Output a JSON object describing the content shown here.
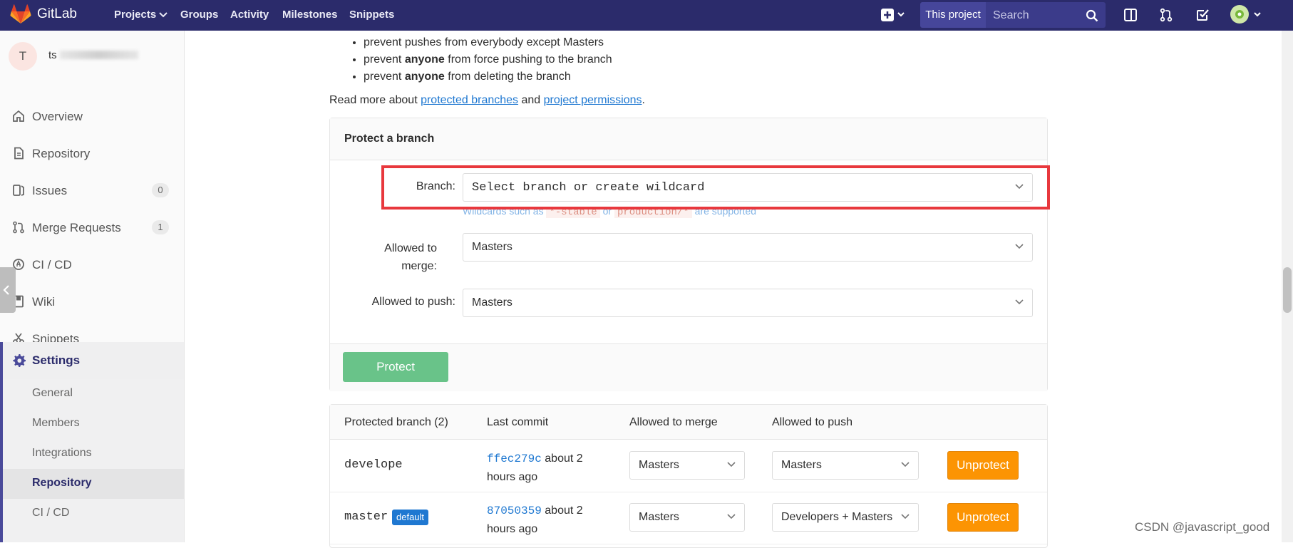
{
  "colors": {
    "navbar": "#2b2b6b",
    "link": "#1f78d1",
    "protect_button": "#69c389",
    "unprotect_button": "#fc9403",
    "highlight": "#e8383d",
    "badge": "#1f78d1"
  },
  "navbar": {
    "brand": "GitLab",
    "items": [
      "Projects",
      "Groups",
      "Activity",
      "Milestones",
      "Snippets"
    ],
    "icons": [
      "gitlab-logo-icon",
      "plus-icon",
      "sidebar-toggle-icon",
      "merge-request-icon",
      "todo-icon",
      "user-avatar-icon"
    ],
    "scope_label": "This project",
    "search_placeholder": "Search"
  },
  "sidebar": {
    "avatar_letter": "T",
    "project_name": "ts",
    "items": [
      {
        "label": "Overview",
        "icon": "home-icon"
      },
      {
        "label": "Repository",
        "icon": "document-icon"
      },
      {
        "label": "Issues",
        "icon": "issues-icon",
        "count": "0"
      },
      {
        "label": "Merge Requests",
        "icon": "merge-request-icon",
        "count": "1"
      },
      {
        "label": "CI / CD",
        "icon": "rocket-icon"
      },
      {
        "label": "Wiki",
        "icon": "book-icon"
      },
      {
        "label": "Snippets",
        "icon": "scissors-icon"
      },
      {
        "label": "Settings",
        "icon": "gear-icon"
      }
    ],
    "settings_sub": [
      "General",
      "Members",
      "Integrations",
      "Repository",
      "CI / CD"
    ]
  },
  "main": {
    "bullets": [
      {
        "before": "prevent pushes from everybody except Masters",
        "bold": "",
        "after": ""
      },
      {
        "before": "prevent ",
        "bold": "anyone",
        "after": " from force pushing to the branch"
      },
      {
        "before": "prevent ",
        "bold": "anyone",
        "after": " from deleting the branch"
      }
    ],
    "read_more": {
      "prefix": "Read more about ",
      "link1": "protected branches",
      "middle": " and ",
      "link2": "project permissions",
      "suffix": "."
    },
    "protect_form": {
      "title": "Protect a branch",
      "branch_label": "Branch:",
      "branch_placeholder": "Select branch or create wildcard",
      "help": {
        "prefix": "Wildcards such as ",
        "code1": "*-stable",
        "middle": " or ",
        "code2": "production/*",
        "suffix": " are supported"
      },
      "merge_label": "Allowed to merge:",
      "merge_value": "Masters",
      "push_label": "Allowed to push:",
      "push_value": "Masters",
      "submit": "Protect"
    },
    "table": {
      "headers": [
        "Protected branch (2)",
        "Last commit",
        "Allowed to merge",
        "Allowed to push"
      ],
      "rows": [
        {
          "branch": "develope",
          "badge": "",
          "sha": "ffec279c",
          "time": "about 2 hours ago",
          "merge": "Masters",
          "push": "Masters",
          "action": "Unprotect"
        },
        {
          "branch": "master",
          "badge": "default",
          "sha": "87050359",
          "time": "about 2 hours ago",
          "merge": "Masters",
          "push": "Developers + Masters",
          "action": "Unprotect"
        }
      ]
    }
  },
  "watermark": "CSDN @javascript_good"
}
